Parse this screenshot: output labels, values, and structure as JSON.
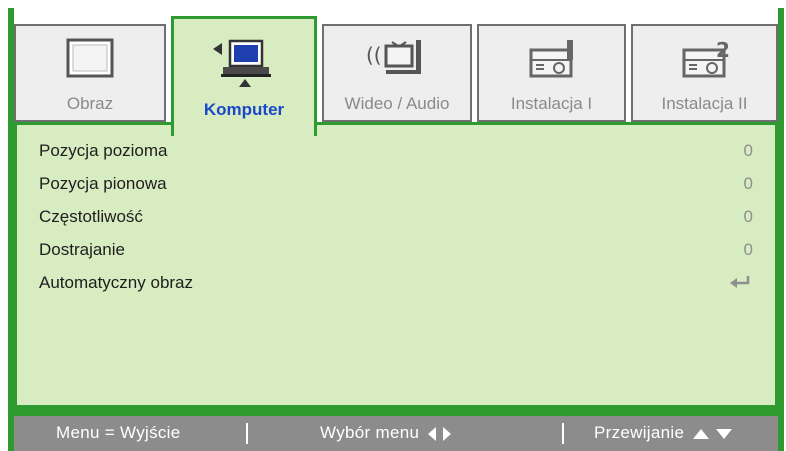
{
  "tabs": [
    {
      "label": "Obraz",
      "icon": "monitor-icon",
      "active": false
    },
    {
      "label": "Komputer",
      "icon": "computer-icon",
      "active": true
    },
    {
      "label": "Wideo / Audio",
      "icon": "video-audio-icon",
      "active": false
    },
    {
      "label": "Instalacja I",
      "icon": "projector-icon",
      "active": false
    },
    {
      "label": "Instalacja II",
      "icon": "projector-2-icon",
      "active": false
    }
  ],
  "menu": {
    "items": [
      {
        "label": "Pozycja pozioma",
        "value": "0"
      },
      {
        "label": "Pozycja pionowa",
        "value": "0"
      },
      {
        "label": "Częstotliwość",
        "value": "0"
      },
      {
        "label": "Dostrajanie",
        "value": "0"
      },
      {
        "label": "Automatyczny obraz",
        "icon": "enter-icon"
      }
    ]
  },
  "footer": {
    "exit": "Menu = Wyjście",
    "select": "Wybór menu",
    "scroll": "Przewijanie"
  },
  "colors": {
    "frame_green": "#2f9a2f",
    "panel_green": "#d7ecc0",
    "active_label_blue": "#1a48c8",
    "footer_gray": "#8c8c8c"
  }
}
